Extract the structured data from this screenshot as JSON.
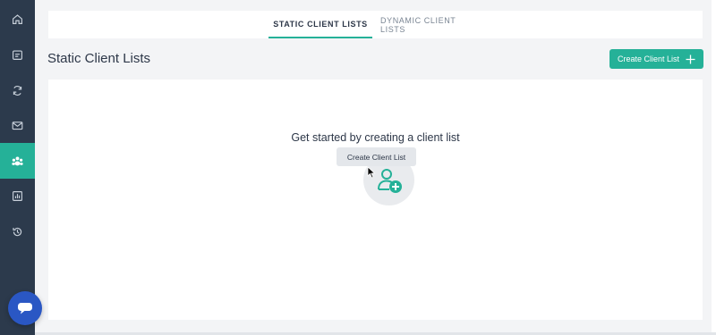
{
  "sidebar": {
    "items": [
      {
        "icon": "home-icon"
      },
      {
        "icon": "calendar-icon"
      },
      {
        "icon": "sync-icon"
      },
      {
        "icon": "mail-icon"
      },
      {
        "icon": "clients-icon",
        "active": true
      },
      {
        "icon": "reports-icon"
      },
      {
        "icon": "history-icon"
      }
    ],
    "accent_color": "#25b198",
    "background_color": "#2c3a4c"
  },
  "tabs": [
    {
      "label": "STATIC CLIENT LISTS",
      "active": true
    },
    {
      "label": "DYNAMIC CLIENT LISTS",
      "active": false
    }
  ],
  "header": {
    "title": "Static Client Lists",
    "create_button_label": "Create Client List"
  },
  "empty_state": {
    "icon": "add-user-icon",
    "message": "Get started by creating a client list",
    "button_label": "Create Client List"
  },
  "chat": {
    "icon": "chat-icon",
    "color": "#2a57c4"
  }
}
